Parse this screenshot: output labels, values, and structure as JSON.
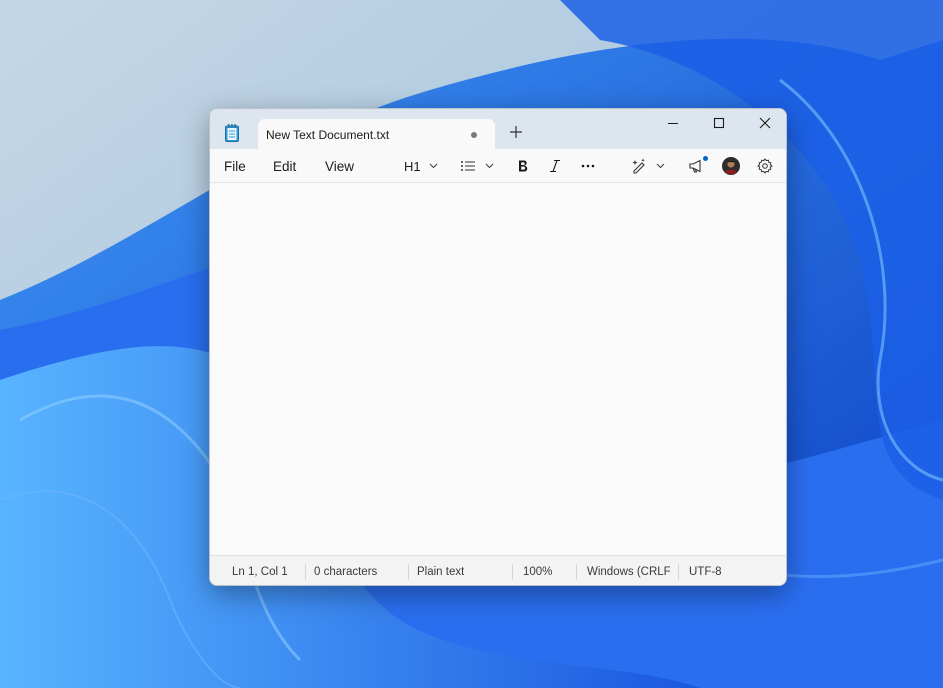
{
  "tab": {
    "title": "New Text Document.txt"
  },
  "menu": {
    "file": "File",
    "edit": "Edit",
    "view": "View"
  },
  "toolbar": {
    "heading": "H1"
  },
  "status": {
    "position": "Ln 1, Col 1",
    "characters": "0 characters",
    "format": "Plain text",
    "zoom": "100%",
    "line_ending": "Windows (CRLF)",
    "encoding": "UTF-8"
  },
  "colors": {
    "accent": "#0067c0",
    "titlebar": "#dde6ee",
    "editor": "#fafafa"
  }
}
